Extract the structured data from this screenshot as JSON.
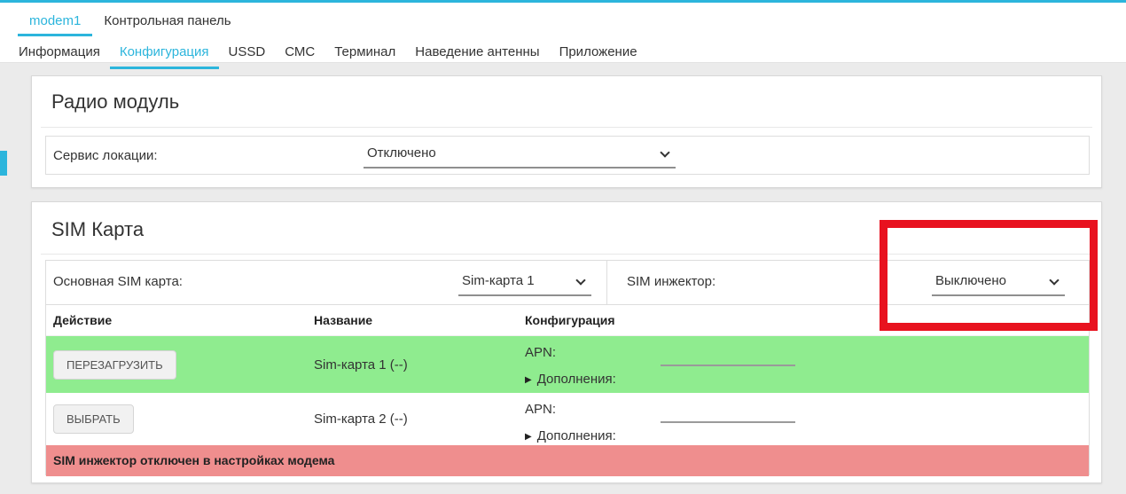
{
  "colors": {
    "accent": "#2cb5dc",
    "row_ok_green": "#8fec8f",
    "alert_pink": "#ef8e8e",
    "highlight_red": "#e8121f"
  },
  "header": {
    "breadcrumb_tabs": [
      {
        "label": "modem1",
        "active": true
      },
      {
        "label": "Контрольная панель",
        "active": false
      }
    ],
    "nav_tabs": [
      {
        "label": "Информация",
        "active": false
      },
      {
        "label": "Конфигурация",
        "active": true
      },
      {
        "label": "USSD",
        "active": false
      },
      {
        "label": "СМС",
        "active": false
      },
      {
        "label": "Терминал",
        "active": false
      },
      {
        "label": "Наведение антенны",
        "active": false
      },
      {
        "label": "Приложение",
        "active": false
      }
    ]
  },
  "radio_module": {
    "title": "Радио модуль",
    "location_service_label": "Сервис локации:",
    "location_service_value": "Отключено"
  },
  "sim_card": {
    "title": "SIM Карта",
    "primary_sim_label": "Основная SIM карта:",
    "primary_sim_value": "Sim-карта 1",
    "injector_label": "SIM инжектор:",
    "injector_value": "Выключено",
    "table": {
      "headers": [
        "Действие",
        "Название",
        "Конфигурация"
      ],
      "rows": [
        {
          "action": "ПЕРЕЗАГРУЗИТЬ",
          "name": "Sim-карта 1 (--)",
          "apn_label": "APN:",
          "apn_value": "",
          "extras_label": "Дополнения:"
        },
        {
          "action": "ВЫБРАТЬ",
          "name": "Sim-карта 2 (--)",
          "apn_label": "APN:",
          "apn_value": "",
          "extras_label": "Дополнения:"
        }
      ]
    },
    "alert": "SIM инжектор отключен в настройках модема"
  }
}
